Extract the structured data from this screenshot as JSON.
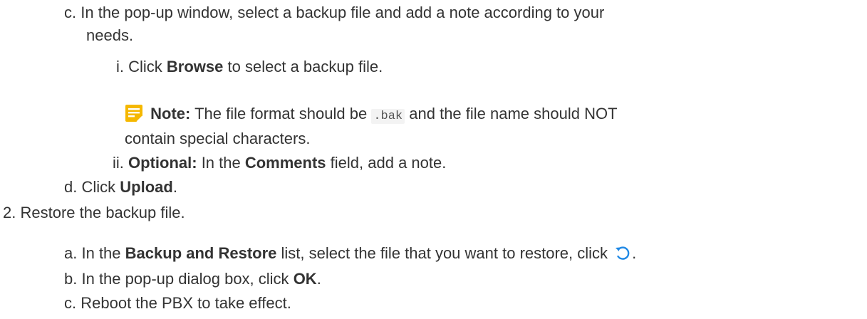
{
  "steps": {
    "c": {
      "marker": "c.",
      "text_line1": "In the pop-up window, select a backup file and add a note according to your",
      "text_line2": "needs."
    },
    "c_i": {
      "marker": "i.",
      "pre": "Click",
      "bold": "Browse",
      "post": "to select a backup file."
    },
    "note": {
      "icon": "note-icon",
      "label": "Note:",
      "pre": "The file format should be",
      "code": ".bak",
      "post": "and the file name should NOT",
      "line2": "contain special characters."
    },
    "c_ii": {
      "marker": "ii.",
      "bold1": "Optional:",
      "pre": "In the",
      "bold2": "Comments",
      "post": "field, add a note."
    },
    "d": {
      "marker": "d.",
      "pre": "Click",
      "bold": "Upload",
      "post": "."
    },
    "step2": {
      "marker": "2.",
      "text": "Restore the backup file."
    },
    "a": {
      "marker": "a.",
      "pre": "In the",
      "bold": "Backup and Restore",
      "post": "list, select the file that you want to restore, click",
      "icon": "restore-icon",
      "end": "."
    },
    "b": {
      "marker": "b.",
      "pre": "In the pop-up dialog box, click",
      "bold": "OK",
      "post": "."
    },
    "c2": {
      "marker": "c.",
      "text": "Reboot the PBX to take effect."
    }
  },
  "colors": {
    "text": "#333333",
    "note_icon": "#f5b800",
    "restore_icon": "#1e88e5"
  }
}
